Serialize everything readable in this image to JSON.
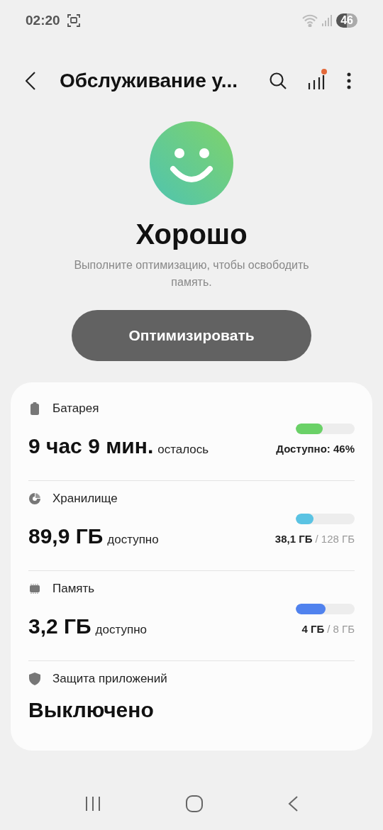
{
  "status_bar": {
    "time": "02:20",
    "battery": "46"
  },
  "top_bar": {
    "title": "Обслуживание у...",
    "has_notification": true
  },
  "summary": {
    "status": "Хорошо",
    "message": "Выполните оптимизацию, чтобы освободить память.",
    "button": "Оптимизировать"
  },
  "items": [
    {
      "kind": "battery",
      "label": "Батарея",
      "value": "9 час 9 мин.",
      "suffix": "осталось",
      "level": 0.46,
      "color": "#6ad167",
      "reading": "Доступно: 46%"
    },
    {
      "kind": "storage",
      "label": "Хранилище",
      "value": "89,9 ГБ",
      "suffix": "доступно",
      "level": 0.3,
      "color": "#5ac3e3",
      "reading": "38,1 ГБ",
      "reading_total": "/ 128 ГБ"
    },
    {
      "kind": "memory",
      "label": "Память",
      "value": "3,2 ГБ",
      "suffix": "доступно",
      "level": 0.5,
      "color": "#5082ee",
      "reading": "4 ГБ",
      "reading_total": "/ 8 ГБ"
    },
    {
      "kind": "protection",
      "label": "Защита приложений",
      "value": "Выключено"
    }
  ]
}
